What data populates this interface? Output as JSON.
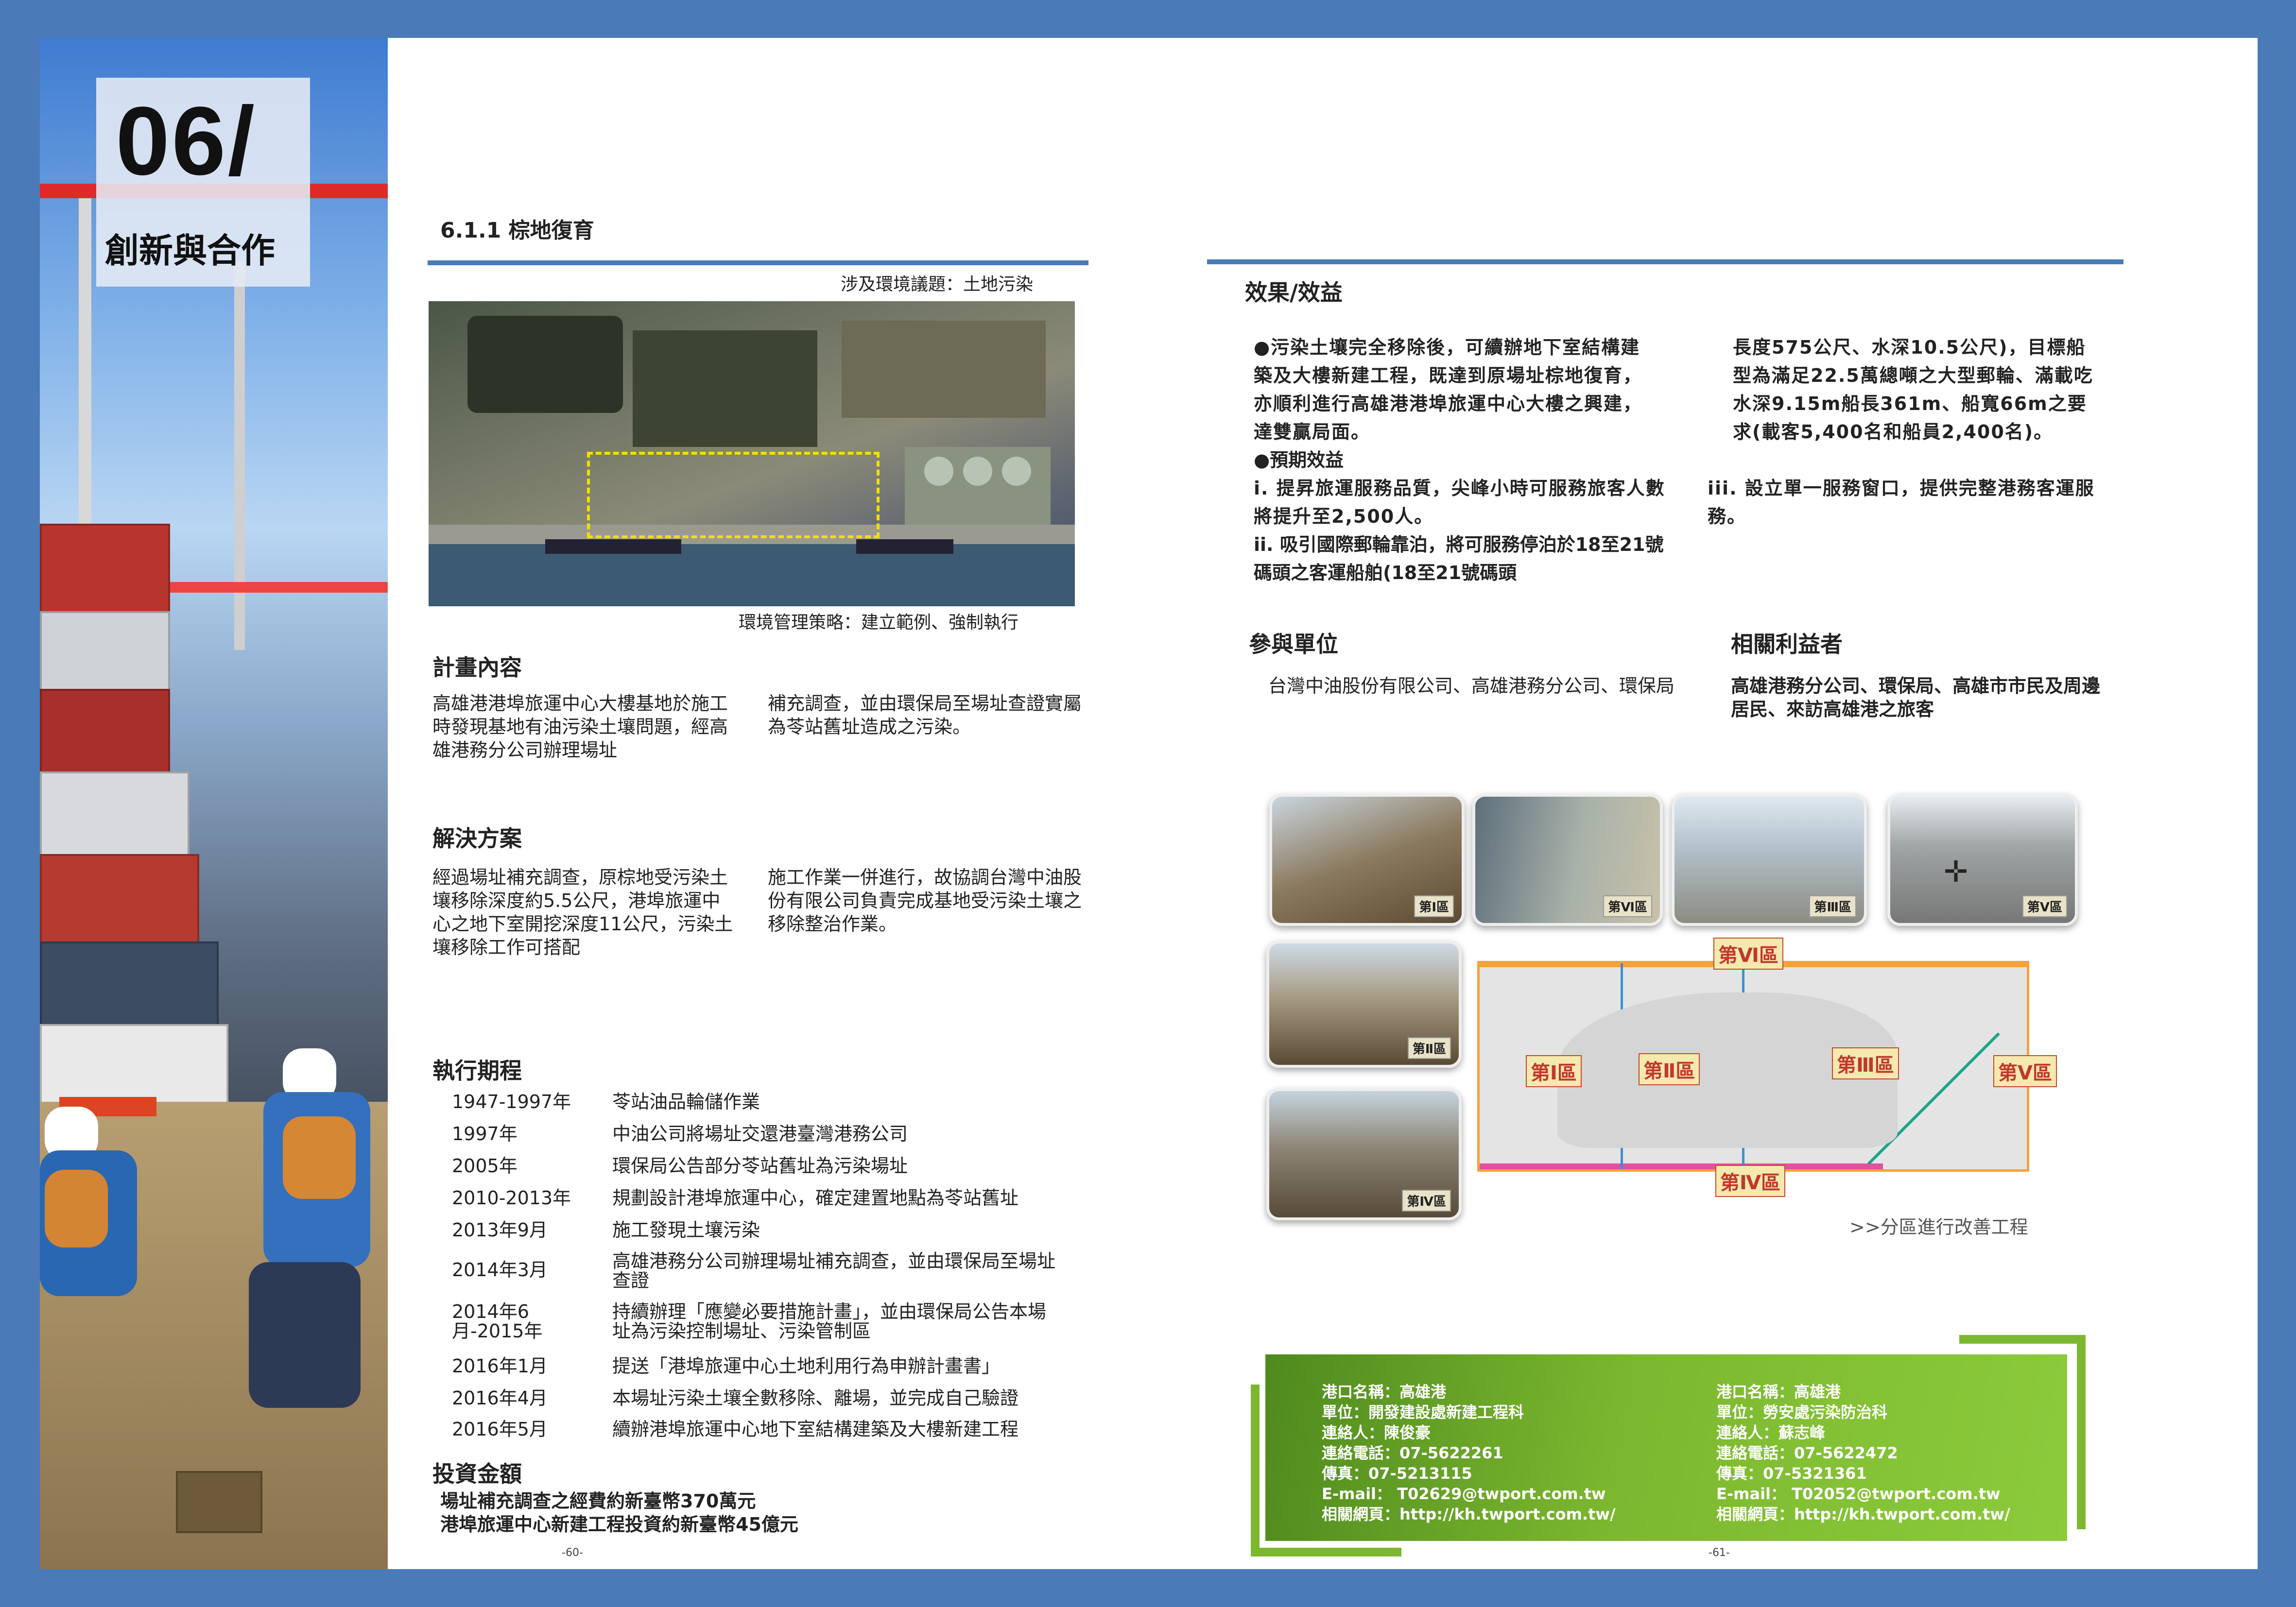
{
  "chapter": {
    "number": "06/",
    "title": "創新與合作"
  },
  "section": {
    "title": "6.1.1 棕地復育"
  },
  "env_issue": "涉及環境議題：土地污染",
  "env_strategy": "環境管理策略：建立範例、強制執行",
  "plan": {
    "heading": "計畫內容",
    "col1": "高雄港港埠旅運中心大樓基地於施工時發現基地有油污染土壤問題，經高雄港務分公司辦理場址",
    "col2": "補充調查，並由環保局至場址查證實屬為苓站舊址造成之污染。"
  },
  "solution": {
    "heading": "解決方案",
    "col1": "經過場址補充調查，原棕地受污染土壤移除深度約5.5公尺，港埠旅運中心之地下室開挖深度11公尺，污染土壤移除工作可搭配",
    "col2": "施工作業一併進行，故協調台灣中油股份有限公司負責完成基地受污染土壤之移除整治作業。"
  },
  "timeline": {
    "heading": "執行期程",
    "rows": [
      {
        "year": "1947-1997年",
        "desc": "苓站油品輪儲作業"
      },
      {
        "year": "1997年",
        "desc": "中油公司將場址交還港臺灣港務公司"
      },
      {
        "year": "2005年",
        "desc": "環保局公告部分苓站舊址為污染場址"
      },
      {
        "year": "2010-2013年",
        "desc": "規劃設計港埠旅運中心，確定建置地點為苓站舊址"
      },
      {
        "year": "2013年9月",
        "desc": "施工發現土壤污染"
      },
      {
        "year": "2014年3月",
        "desc": "高雄港務分公司辦理場址補充調查，並由環保局至場址查證"
      },
      {
        "year": "2014年6月-2015年",
        "desc": "持續辦理「應變必要措施計畫」，並由環保局公告本場址為污染控制場址、污染管制區"
      },
      {
        "year": "2016年1月",
        "desc": "提送「港埠旅運中心土地利用行為申辦計畫書」"
      },
      {
        "year": "2016年4月",
        "desc": "本場址污染土壤全數移除、離場，並完成自己驗證"
      },
      {
        "year": "2016年5月",
        "desc": "續辦港埠旅運中心地下室結構建築及大樓新建工程"
      }
    ]
  },
  "investment": {
    "heading": "投資金額",
    "line1": "場址補充調查之經費約新臺幣370萬元",
    "line2": "港埠旅運中心新建工程投資約新臺幣45億元"
  },
  "effects": {
    "heading": "效果/效益",
    "bullet1": "●污染土壤完全移除後，可續辦地下室結構建築及大樓新建工程，既達到原場址棕地復育，亦順利進行高雄港港埠旅運中心大樓之興建，達雙贏局面。",
    "bullet2": "●預期效益",
    "item_i": "i. 提昇旅運服務品質，尖峰小時可服務旅客人數將提升至2,500人。",
    "item_ii": "ii. 吸引國際郵輪靠泊，將可服務停泊於18至21號碼頭之客運船舶(18至21號碼頭",
    "col2_cont": "長度575公尺、水深10.5公尺)，目標船型為滿足22.5萬總噸之大型郵輪、滿載吃水深9.15m船長361m、船寬66m之要求(載客5,400名和船員2,400名)。",
    "item_iii": "iii. 設立單一服務窗口，提供完整港務客運服務。"
  },
  "participants": {
    "heading": "參與單位",
    "text": "台灣中油股份有限公司、高雄港務分公司、環保局"
  },
  "stakeholders": {
    "heading": "相關利益者",
    "text": "高雄港務分公司、環保局、高雄市市民及周邊居民、來訪高雄港之旅客"
  },
  "zones": {
    "photo_labels": [
      "第Ⅰ區",
      "第Ⅵ區",
      "第Ⅲ區",
      "第Ⅴ區",
      "第Ⅱ區",
      "第Ⅳ區"
    ],
    "map_labels": {
      "top": "第Ⅵ區",
      "z1": "第Ⅰ區",
      "z2": "第Ⅱ區",
      "z3": "第Ⅲ區",
      "z5": "第Ⅴ區",
      "bottom": "第Ⅳ區"
    },
    "caption": ">>分區進行改善工程"
  },
  "contacts": [
    {
      "port": "港口名稱：高雄港",
      "unit": "單位：開發建設處新建工程科",
      "person": "連絡人：陳俊豪",
      "phone": "連絡電話：07-5622261",
      "fax": "傳真：07-5213115",
      "email": "E-mail： T02629@twport.com.tw",
      "web": "相關網頁：http://kh.twport.com.tw/"
    },
    {
      "port": "港口名稱：高雄港",
      "unit": "單位：勞安處污染防治科",
      "person": "連絡人：蘇志峰",
      "phone": "連絡電話：07-5622472",
      "fax": "傳真：07-5321361",
      "email": "E-mail： T02052@twport.com.tw",
      "web": "相關網頁：http://kh.twport.com.tw/"
    }
  ],
  "page_numbers": {
    "left": "-60-",
    "right": "-61-"
  },
  "colors": {
    "accent_blue": "#4a7ab8",
    "green": "#7cb82f",
    "highlight_yellow": "#f0e000"
  }
}
